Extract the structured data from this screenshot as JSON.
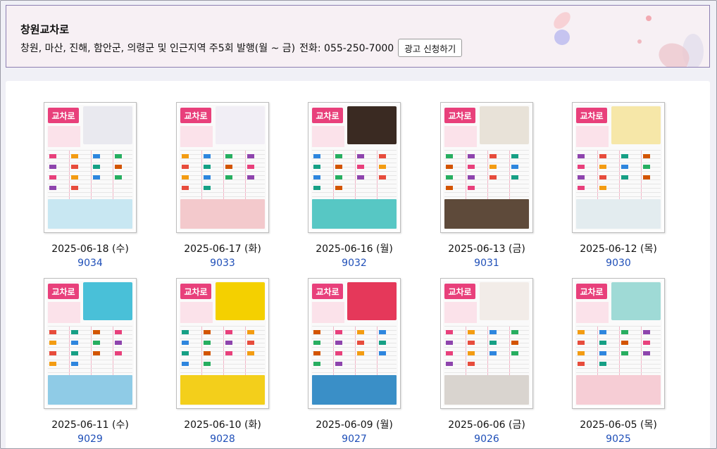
{
  "header": {
    "title": "창원교차로",
    "subtitle": "창원, 마산, 진해, 함안군, 의령군 및 인근지역 주5회 발행(월 ~ 금)",
    "phone": "전화: 055-250-7000",
    "ad_button_label": "광고 신청하기"
  },
  "thumb_logo": "교차로",
  "issues": [
    {
      "date": "2025-06-18 (수)",
      "number": "9034",
      "top_color": "#e9e9ef",
      "bottom_color": "#c8e7f2"
    },
    {
      "date": "2025-06-17 (화)",
      "number": "9033",
      "top_color": "#f1eef5",
      "bottom_color": "#f3c9cc"
    },
    {
      "date": "2025-06-16 (월)",
      "number": "9032",
      "top_color": "#3a2a22",
      "bottom_color": "#57c7c4"
    },
    {
      "date": "2025-06-13 (금)",
      "number": "9031",
      "top_color": "#e8e2d8",
      "bottom_color": "#5e4a3a"
    },
    {
      "date": "2025-06-12 (목)",
      "number": "9030",
      "top_color": "#f6e7a8",
      "bottom_color": "#e3ecef"
    },
    {
      "date": "2025-06-11 (수)",
      "number": "9029",
      "top_color": "#49c0d8",
      "bottom_color": "#8fcbe6"
    },
    {
      "date": "2025-06-10 (화)",
      "number": "9028",
      "top_color": "#f4d000",
      "bottom_color": "#f3cf1b"
    },
    {
      "date": "2025-06-09 (월)",
      "number": "9027",
      "top_color": "#e5385a",
      "bottom_color": "#3a8fc7"
    },
    {
      "date": "2025-06-06 (금)",
      "number": "9026",
      "top_color": "#f2ece8",
      "bottom_color": "#d9d4cf"
    },
    {
      "date": "2025-06-05 (목)",
      "number": "9025",
      "top_color": "#9fdad6",
      "bottom_color": "#f6cdd5"
    }
  ]
}
